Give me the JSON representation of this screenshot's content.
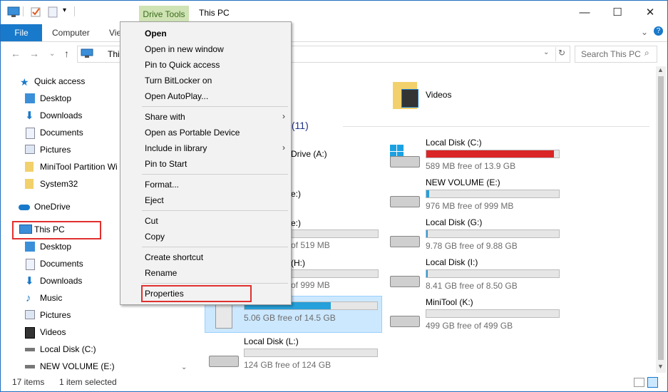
{
  "window": {
    "title": "This PC",
    "context_tab": "Drive Tools"
  },
  "ribbon": {
    "tabs": [
      "File",
      "Computer",
      "View"
    ]
  },
  "address": {
    "path": "This PC",
    "search_placeholder": "Search This PC"
  },
  "nav": {
    "items": [
      {
        "label": "Quick access",
        "icon": "star-icon"
      },
      {
        "label": "Desktop",
        "icon": "desktop-icon"
      },
      {
        "label": "Downloads",
        "icon": "download-icon"
      },
      {
        "label": "Documents",
        "icon": "document-icon"
      },
      {
        "label": "Pictures",
        "icon": "pictures-icon"
      },
      {
        "label": "MiniTool Partition Wi",
        "icon": "folder-icon"
      },
      {
        "label": "System32",
        "icon": "folder-icon"
      },
      {
        "label": "OneDrive",
        "icon": "cloud-icon"
      },
      {
        "label": "This PC",
        "icon": "computer-icon"
      },
      {
        "label": "Desktop",
        "icon": "desktop-icon"
      },
      {
        "label": "Documents",
        "icon": "document-icon"
      },
      {
        "label": "Downloads",
        "icon": "download-icon"
      },
      {
        "label": "Music",
        "icon": "music-icon"
      },
      {
        "label": "Pictures",
        "icon": "pictures-icon"
      },
      {
        "label": "Videos",
        "icon": "video-icon"
      },
      {
        "label": "Local Disk (C:)",
        "icon": "drive-icon"
      },
      {
        "label": "NEW VOLUME (E:)",
        "icon": "drive-icon"
      }
    ]
  },
  "content": {
    "videos_label": "Videos",
    "section_header_partial": "s (11)",
    "drives_left_partial": [
      {
        "name": "Drive (A:)"
      },
      {
        "name": "e:)"
      },
      {
        "name": "e:)",
        "free": "of 519 MB",
        "fill": 0.0
      },
      {
        "name": "(H:)",
        "free": "of 999 MB",
        "fill": 0.0
      }
    ],
    "drives": [
      {
        "name": "Local Disk (C:)",
        "free": "589 MB free of 13.9 GB",
        "fill": 0.96,
        "color": "#da2626"
      },
      {
        "name": "NEW VOLUME (E:)",
        "free": "976 MB free of 999 MB",
        "fill": 0.02,
        "color": "#26a0da"
      },
      {
        "name": "Local Disk (G:)",
        "free": "9.78 GB free of 9.88 GB",
        "fill": 0.01,
        "color": "#26a0da"
      },
      {
        "name": "Local Disk (I:)",
        "free": "8.41 GB free of 8.50 GB",
        "fill": 0.01,
        "color": "#26a0da"
      },
      {
        "name": "MiniTool (K:)",
        "free": "499 GB free of 499 GB",
        "fill": 0.0,
        "color": "#26a0da"
      },
      {
        "name": "",
        "free": "5.06 GB free of 14.5 GB",
        "fill": 0.65,
        "color": "#26a0da"
      },
      {
        "name": "Local Disk (L:)",
        "free": "124 GB free of 124 GB",
        "fill": 0.0,
        "color": "#26a0da"
      }
    ]
  },
  "menu": {
    "items": [
      "Open",
      "Open in new window",
      "Pin to Quick access",
      "Turn BitLocker on",
      "Open AutoPlay...",
      "Share with",
      "Open as Portable Device",
      "Include in library",
      "Pin to Start",
      "Format...",
      "Eject",
      "Cut",
      "Copy",
      "Create shortcut",
      "Rename",
      "Properties"
    ]
  },
  "status": {
    "count": "17 items",
    "selected": "1 item selected"
  }
}
